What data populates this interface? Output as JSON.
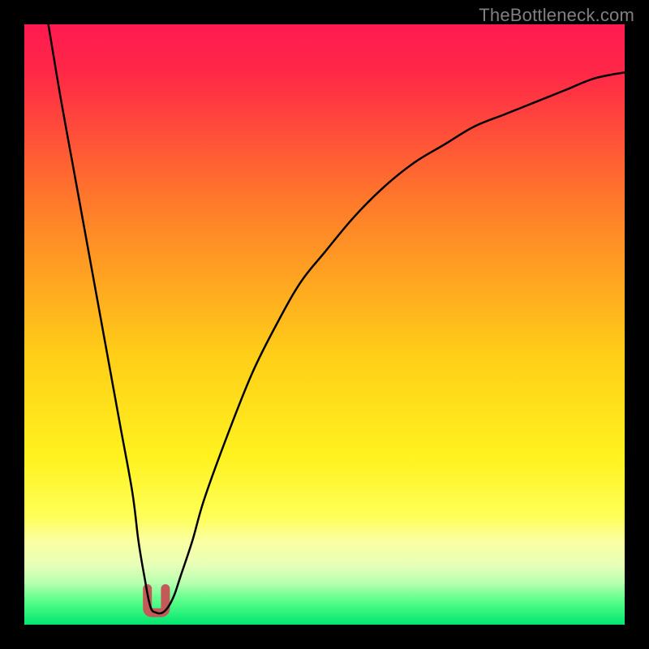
{
  "watermark": "TheBottleneck.com",
  "chart_data": {
    "type": "line",
    "title": "",
    "xlabel": "",
    "ylabel": "",
    "xlim": [
      0,
      100
    ],
    "ylim": [
      0,
      100
    ],
    "grid": false,
    "legend": false,
    "series": [
      {
        "name": "curve",
        "color": "#000000",
        "x": [
          4,
          6,
          8,
          10,
          12,
          14,
          16,
          18,
          19,
          20,
          21,
          22,
          23,
          24,
          25,
          26,
          28,
          30,
          34,
          38,
          42,
          46,
          50,
          55,
          60,
          65,
          70,
          75,
          80,
          85,
          90,
          95,
          100
        ],
        "values": [
          100,
          88,
          77,
          66,
          55,
          44,
          33,
          22,
          14,
          8,
          3,
          2,
          2,
          3,
          5,
          8,
          14,
          21,
          32,
          42,
          50,
          57,
          62,
          68,
          73,
          77,
          80,
          83,
          85,
          87,
          89,
          91,
          92
        ]
      }
    ],
    "dip_marker": {
      "color": "#c45a57",
      "x_range": [
        20.5,
        23.5
      ],
      "y": 2,
      "height": 4
    },
    "background_gradient": {
      "stops": [
        {
          "offset": 0.0,
          "color": "#ff1950"
        },
        {
          "offset": 0.08,
          "color": "#ff2847"
        },
        {
          "offset": 0.3,
          "color": "#ff7b2a"
        },
        {
          "offset": 0.55,
          "color": "#ffce18"
        },
        {
          "offset": 0.72,
          "color": "#fff21f"
        },
        {
          "offset": 0.82,
          "color": "#ffff58"
        },
        {
          "offset": 0.86,
          "color": "#fbffa0"
        },
        {
          "offset": 0.9,
          "color": "#e8ffb8"
        },
        {
          "offset": 0.93,
          "color": "#b8ffb0"
        },
        {
          "offset": 0.96,
          "color": "#5aff8a"
        },
        {
          "offset": 1.0,
          "color": "#00e670"
        }
      ]
    }
  }
}
